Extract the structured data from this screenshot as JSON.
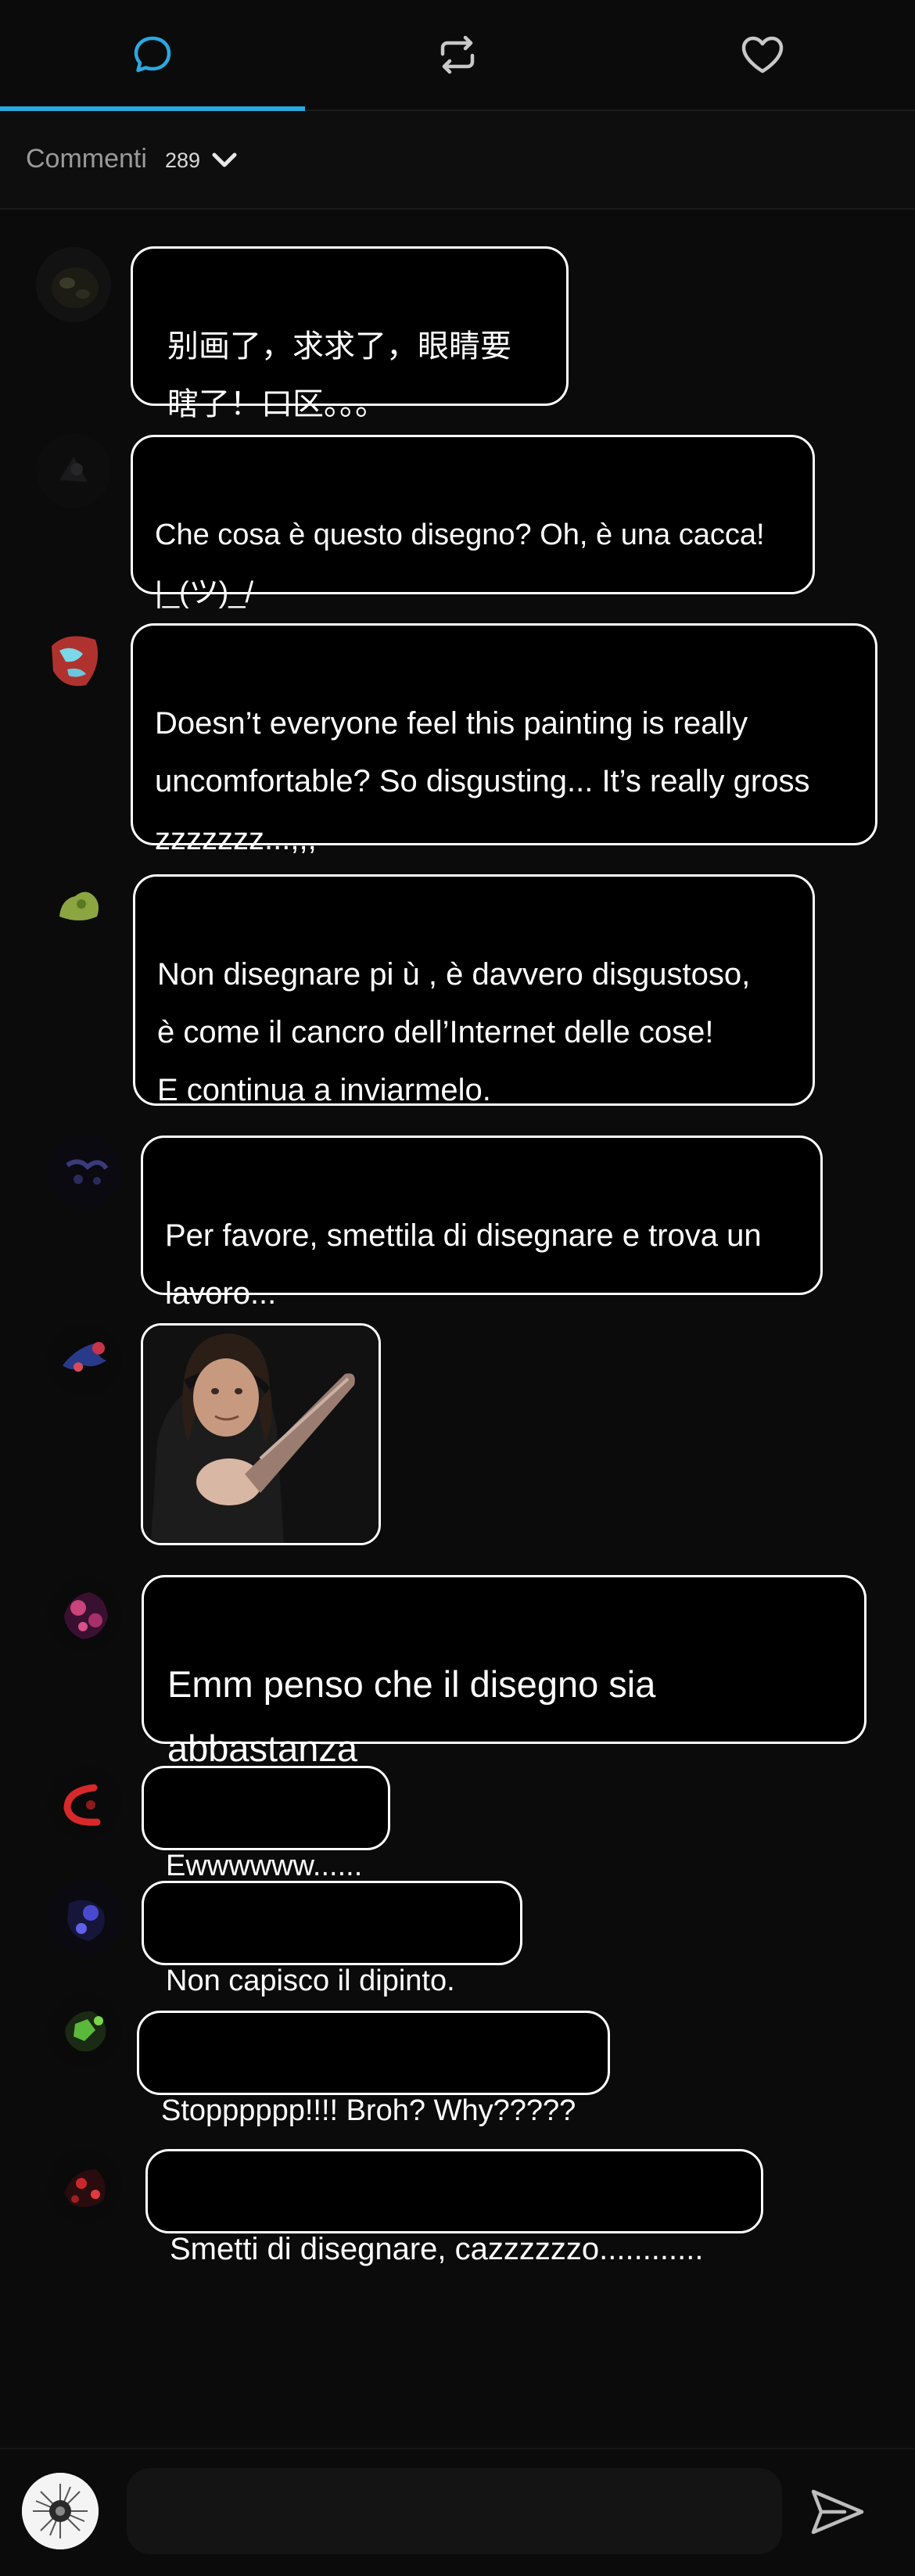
{
  "tabs": [
    {
      "name": "comments",
      "icon": "chat-bubble-icon",
      "active": true
    },
    {
      "name": "reposts",
      "icon": "repost-icon",
      "active": false
    },
    {
      "name": "likes",
      "icon": "heart-icon",
      "active": false
    }
  ],
  "accent_color": "#2aa8e0",
  "comments_header": {
    "label": "Commenti",
    "count": "289"
  },
  "comments": [
    {
      "text": "别画了，求求了，眼睛要\n瞎了！口区。。。"
    },
    {
      "text": "Che cosa  è  questo disegno? Oh,  è  una cacca!\n|_(ツ)_/"
    },
    {
      "text": "Doesn’t everyone feel this painting is really\nuncomfortable? So disgusting... It’s really gross\nzzzzzzz...,,,"
    },
    {
      "text": "Non disegnare pi ù ,  è  davvero disgustoso,\nè  come il cancro dell’Internet delle cose!\nE continua a inviarmelo."
    },
    {
      "text": "Per favore, smettila di disegnare e trova un\nlavoro..."
    },
    {
      "text": "",
      "image": "meme-knife-image"
    },
    {
      "text": "Emm penso che il disegno sia abbastanza\nnormale."
    },
    {
      "text": "Ewwwwww......"
    },
    {
      "text": "Non capisco il dipinto."
    },
    {
      "text": "Stopppppp!!!! Broh? Why?????"
    },
    {
      "text": "Smetti di disegnare, cazzzzzzo............"
    }
  ],
  "input": {
    "placeholder": ""
  }
}
